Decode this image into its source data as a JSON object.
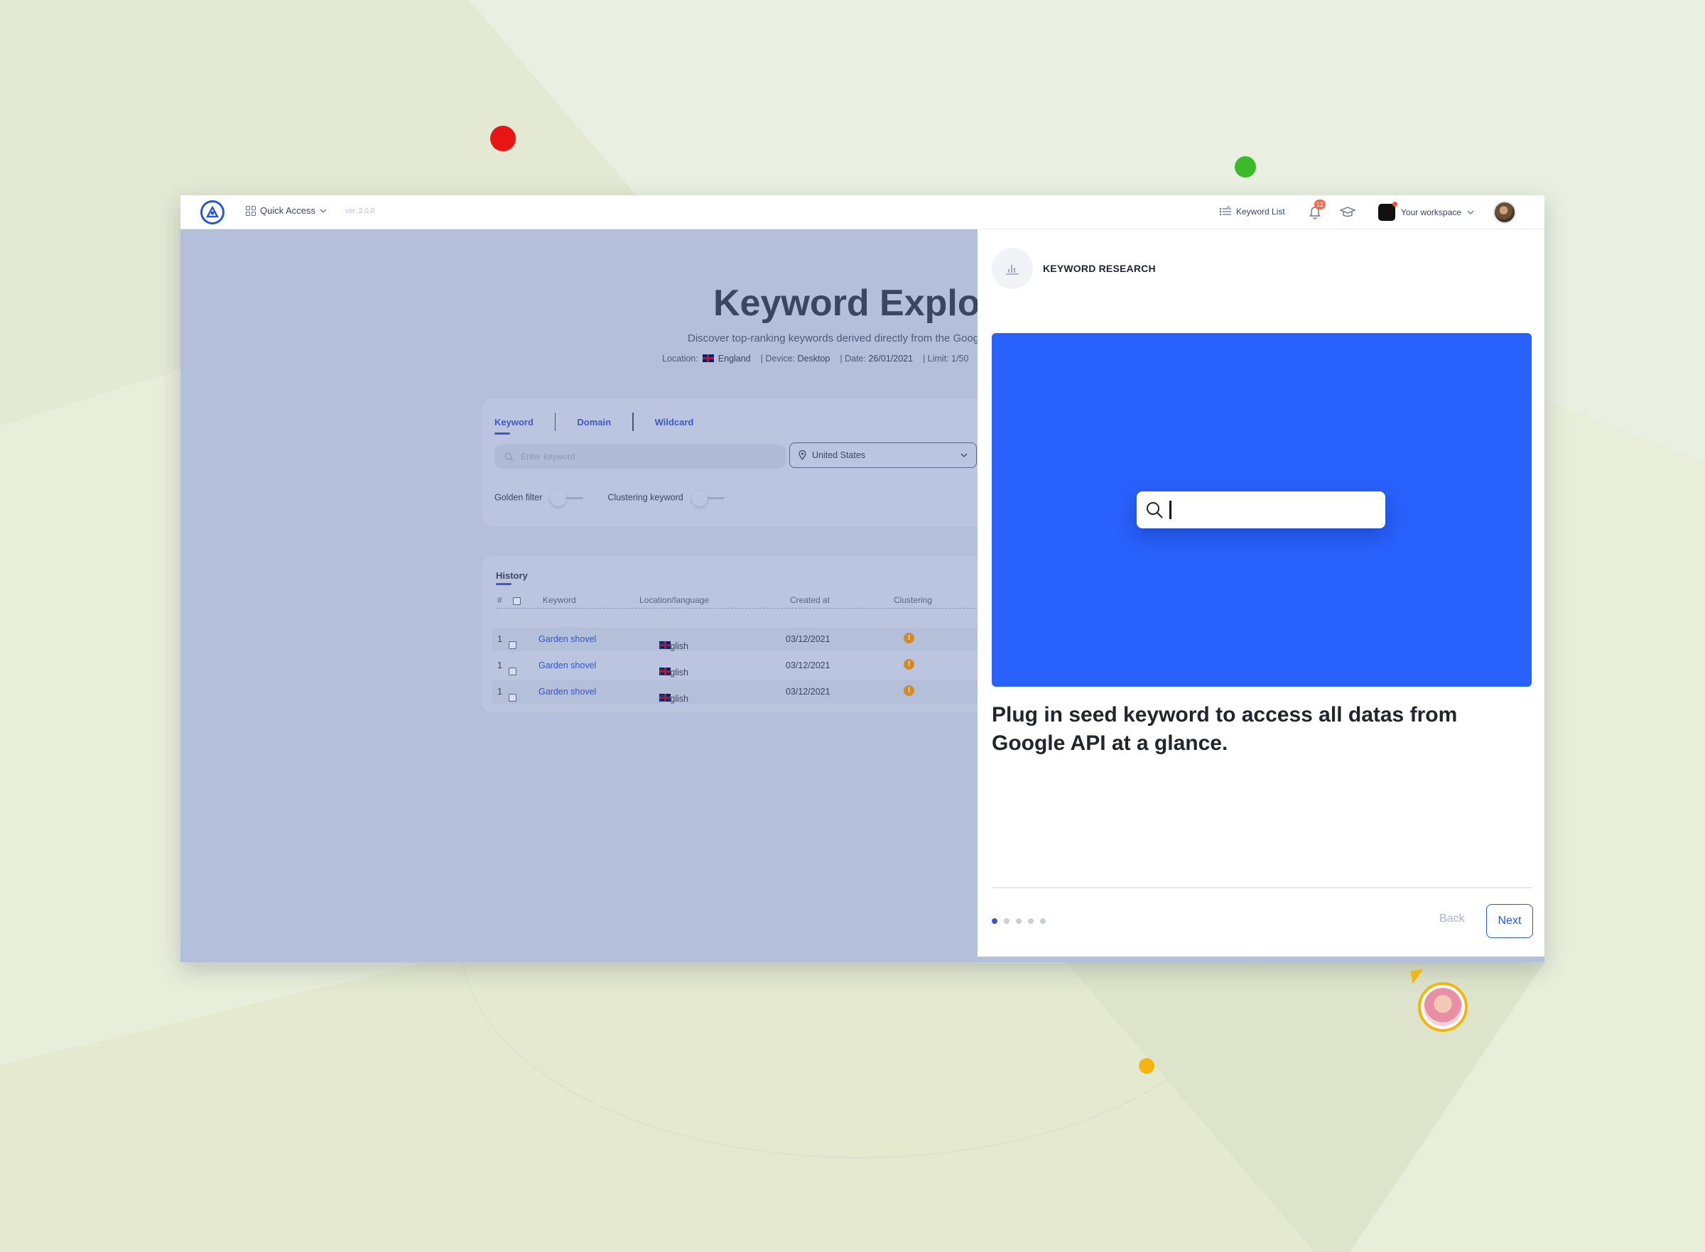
{
  "colors": {
    "accent": "#2b56d9",
    "hero_blue": "#2961fc",
    "dot_red": "#e81515",
    "dot_green": "#3cba2a",
    "dot_yellow": "#f5b50f",
    "warning": "#d18b2d"
  },
  "topbar": {
    "quick_access_label": "Quick Access",
    "version": "ver. 2.0.0",
    "keyword_list_label": "Keyword List",
    "notification_count": "12",
    "workspace_label": "Your workspace"
  },
  "main": {
    "title": "Keyword Explor",
    "subtitle": "Discover top-ranking keywords derived directly from the Goog",
    "meta": {
      "location_label": "Location:",
      "location_value": "England",
      "device_label": "Device:",
      "device_value": "Desktop",
      "date_label": "Date:",
      "date_value": "26/01/2021",
      "limit_label": "Limit: 1/50"
    },
    "tabs": [
      {
        "label": "Keyword"
      },
      {
        "label": "Domain"
      },
      {
        "label": "Wildcard"
      }
    ],
    "keyword_placeholder": "Enter keyword",
    "location_select": "United States",
    "filters": {
      "golden": "Golden filter",
      "clustering": "Clustering keyword"
    },
    "history": {
      "title": "History",
      "columns": [
        "#",
        "Keyword",
        "Location/language",
        "Created at",
        "Clustering"
      ],
      "rows": [
        {
          "index": "1",
          "keyword": "Garden shovel",
          "language": "English",
          "created": "03/12/2021",
          "clustering": "!"
        },
        {
          "index": "1",
          "keyword": "Garden shovel",
          "language": "English",
          "created": "03/12/2021",
          "clustering": "!"
        },
        {
          "index": "1",
          "keyword": "Garden shovel",
          "language": "English",
          "created": "03/12/2021",
          "clustering": "!"
        }
      ]
    }
  },
  "panel": {
    "section_label": "KEYWORD RESEARCH",
    "description": "Plug in seed keyword to access all datas from Google API at a glance.",
    "steps_total": 5,
    "steps_active": 1,
    "back_label": "Back",
    "next_label": "Next"
  }
}
